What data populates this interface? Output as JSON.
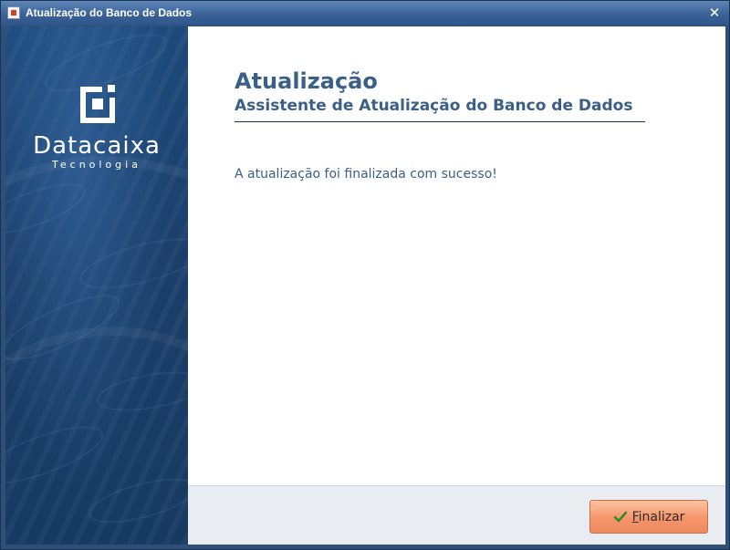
{
  "window": {
    "title": "Atualização do Banco de Dados",
    "close_icon": "close-icon",
    "app_icon": "app-icon"
  },
  "sidebar": {
    "logo_icon": "datacaixa-logo-icon",
    "brand_name": "Datacaixa",
    "brand_tagline": "Tecnologia"
  },
  "main": {
    "heading": "Atualização",
    "subheading": "Assistente de Atualização do Banco de Dados",
    "message": "A atualização foi finalizada com sucesso!"
  },
  "footer": {
    "finish_label": "Finalizar",
    "finish_icon": "check-icon"
  },
  "colors": {
    "titlebar": "#3b6297",
    "sidebar": "#1b3f6a",
    "heading": "#3a5f88",
    "footer_bg": "#e9ecf1",
    "button_accent": "#f5956a",
    "check": "#2f8a2f"
  }
}
